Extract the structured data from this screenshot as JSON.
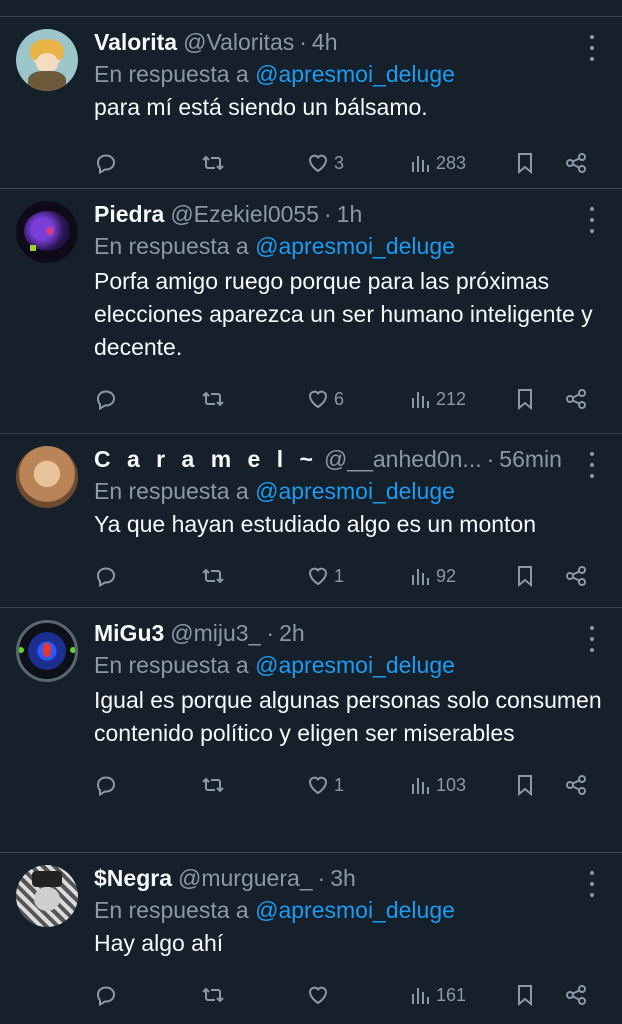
{
  "tweets": [
    {
      "name": "Valorita",
      "handle": "@Valoritas",
      "time": "4h",
      "reply_prefix": "En respuesta a",
      "reply_to": "@apresmoi_deluge",
      "text": "para mí está siendo un bálsamo.",
      "likes": "3",
      "views": "283"
    },
    {
      "name": "Piedra",
      "handle": "@Ezekiel0055",
      "time": "1h",
      "reply_prefix": "En respuesta a",
      "reply_to": "@apresmoi_deluge",
      "text": "Porfa amigo ruego porque para las próximas elecciones aparezca un ser humano inteligente y decente.",
      "likes": "6",
      "views": "212"
    },
    {
      "name": "C a r a m e l ~",
      "handle": "@__anhed0n...",
      "time": "56min",
      "reply_prefix": "En respuesta a",
      "reply_to": "@apresmoi_deluge",
      "text": "Ya que hayan estudiado algo es un monton",
      "likes": "1",
      "views": "92"
    },
    {
      "name": "MiGu3",
      "handle": "@miju3_",
      "time": "2h",
      "reply_prefix": "En respuesta a",
      "reply_to": "@apresmoi_deluge",
      "text": "Igual es porque algunas personas solo consumen contenido político y eligen ser miserables",
      "likes": "1",
      "views": "103"
    },
    {
      "name": "$Negra",
      "handle": "@murguera_",
      "time": "3h",
      "reply_prefix": "En respuesta a",
      "reply_to": "@apresmoi_deluge",
      "text": "Hay algo ahí",
      "likes": "",
      "views": "161"
    }
  ],
  "colors": {
    "background": "#15202b",
    "divider": "#38444d",
    "muted": "#8b98a5",
    "link": "#1d9bf0",
    "text": "#f7f9f9"
  }
}
